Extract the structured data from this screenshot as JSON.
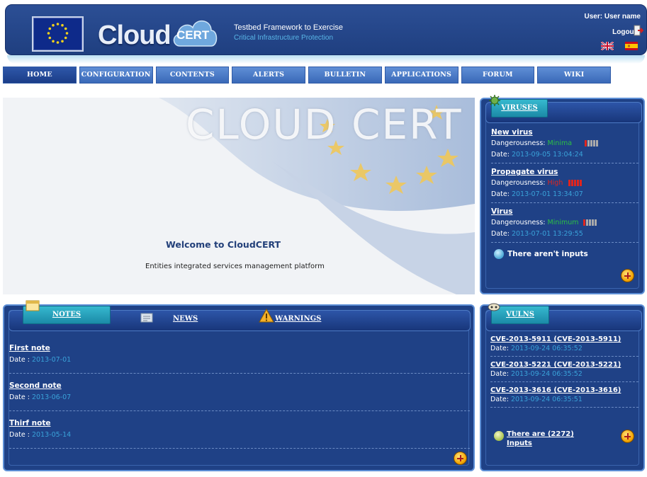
{
  "header": {
    "logo_word": "Cloud",
    "logo_badge": "CERT",
    "tagline_line1": "Testbed Framework to Exercise",
    "tagline_line2": "Critical Infrastructure Protection",
    "user_label": "User: User name",
    "logout_label": "Logout"
  },
  "nav": {
    "items": [
      "HOME",
      "CONFIGURATION",
      "CONTENTS",
      "ALERTS",
      "BULLETIN",
      "APPLICATIONS",
      "FORUM",
      "WIKI"
    ]
  },
  "hero": {
    "banner_text": "CLOUD CERT",
    "welcome": "Welcome to CloudCERT",
    "subtitle": "Entities integrated services management platform"
  },
  "viruses": {
    "tab_label": "VIRUSES",
    "items": [
      {
        "title": "New virus",
        "danger_label": "Dangerousness:",
        "danger_value": "Minima",
        "date_label": "Date:",
        "date": "2013-09-05 13:04:24"
      },
      {
        "title": "Propagate virus",
        "danger_label": "Dangerousness:",
        "danger_value": "High",
        "date_label": "Date:",
        "date": "2013-07-01 13:34:07"
      },
      {
        "title": "Virus",
        "danger_label": "Dangerousness:",
        "danger_value": "Minimum",
        "date_label": "Date:",
        "date": "2013-07-01 13:29:55"
      }
    ],
    "empty_text": "There aren't inputs"
  },
  "notes": {
    "tabs": [
      "NOTES",
      "NEWS",
      "WARNINGS"
    ],
    "items": [
      {
        "title": "First note",
        "date_label": "Date :",
        "date": "2013-07-01"
      },
      {
        "title": "Second note",
        "date_label": "Date :",
        "date": "2013-06-07"
      },
      {
        "title": "Thirf note",
        "date_label": "Date :",
        "date": "2013-05-14"
      }
    ]
  },
  "vulns": {
    "tab_label": "VULNS",
    "items": [
      {
        "title": "CVE-2013-5911 (CVE-2013-5911)",
        "date_label": "Date:",
        "date": "2013-09-24 06:35:52"
      },
      {
        "title": "CVE-2013-5221 (CVE-2013-5221)",
        "date_label": "Date:",
        "date": "2013-09-24 06:35:52"
      },
      {
        "title": "CVE-2013-3616 (CVE-2013-3616)",
        "date_label": "Date:",
        "date": "2013-09-24 06:35:51"
      }
    ],
    "count_line1": "There are (2272)",
    "count_line2": "Inputs"
  },
  "colors": {
    "header_bg": "#2c4f95",
    "nav_bg": "#4a7bc6",
    "panel_bg": "#1f4186",
    "tab_teal": "#2aa8c2",
    "date_blue": "#3aa2d9",
    "danger_green": "#2cc144",
    "danger_red": "#e0251e"
  }
}
